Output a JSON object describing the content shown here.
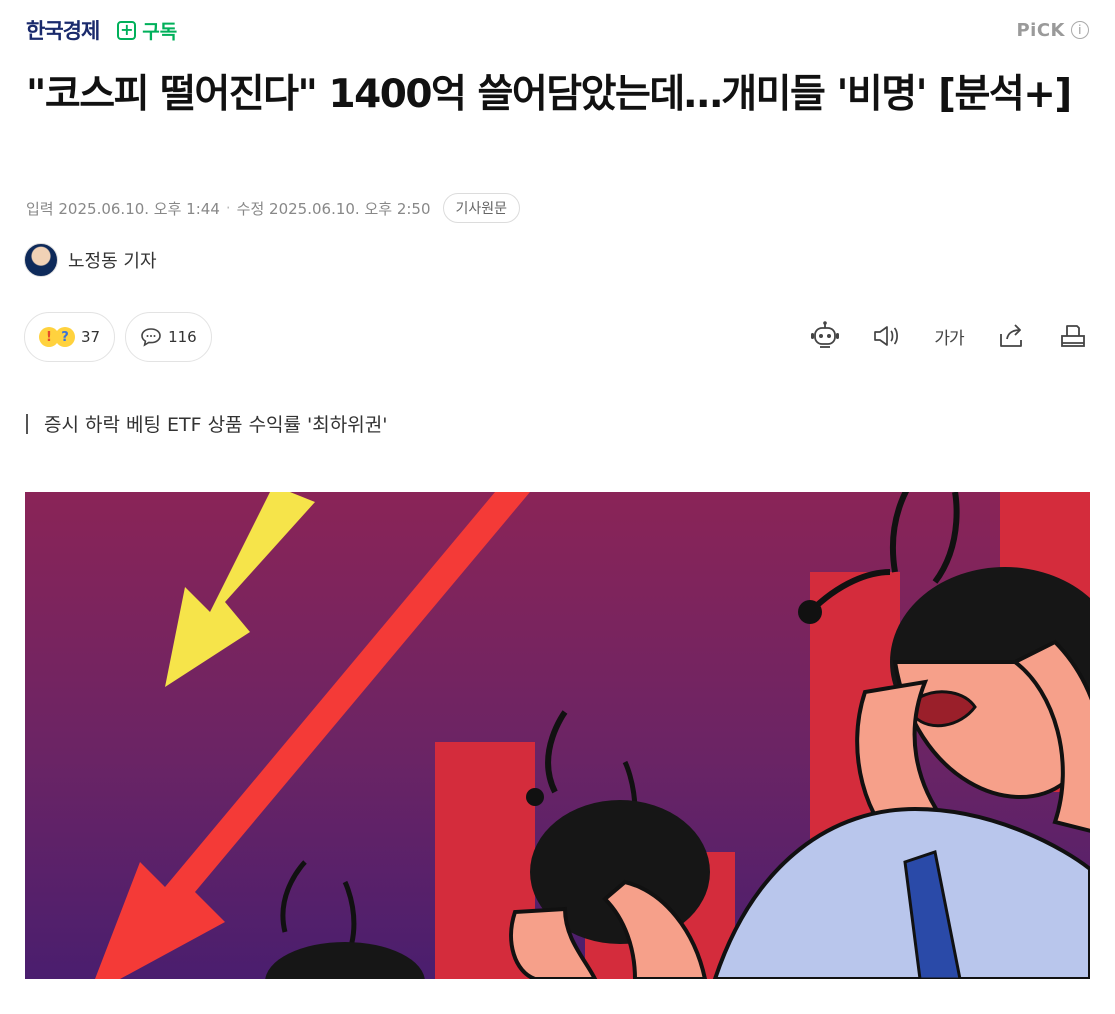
{
  "topbar": {
    "press_name": "한국경제",
    "subscribe_label": "구독",
    "pick_label": "PiCK",
    "info_glyph": "i"
  },
  "article": {
    "title": "\"코스피 떨어진다\" 1400억 쓸어담았는데…개미들 '비명' [분석+]",
    "meta": {
      "input_label": "입력",
      "input_time": "2025.06.10. 오후 1:44",
      "modified_label": "수정",
      "modified_time": "2025.06.10. 오후 2:50",
      "original_button": "기사원문"
    },
    "author": "노정동 기자",
    "reactions": {
      "reaction_count": "37",
      "comment_count": "116"
    },
    "toolbar": {
      "font_size_label": "가가",
      "icons": [
        "robot-summary-icon",
        "speaker-icon",
        "font-size-icon",
        "share-icon",
        "print-icon"
      ]
    },
    "subheading": "증시 하락 베팅 ETF 상품 수익률 '최하위권'"
  },
  "colors": {
    "press": "#1a2a6c",
    "subscribe": "#00b05a",
    "hero_bg_top": "#8a2457",
    "hero_bg_bottom": "#4a1e6e"
  }
}
